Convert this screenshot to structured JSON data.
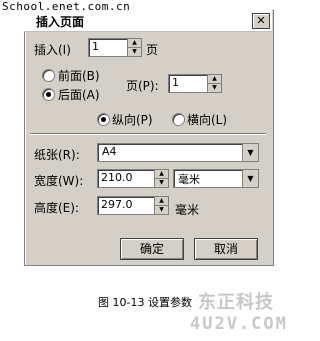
{
  "watermark_top": "School.enet.com.cn",
  "dialog": {
    "title": "插入页面",
    "close_glyph": "✕",
    "insert_label": "插入(I)",
    "insert_value": "1",
    "insert_unit": "页",
    "before_label": "前面(B)",
    "after_label": "后面(A)",
    "page_label": "页(P):",
    "page_value": "1",
    "portrait_label": "纵向(P)",
    "landscape_label": "横向(L)",
    "paper_label": "纸张(R):",
    "paper_value": "A4",
    "width_label": "宽度(W):",
    "width_value": "210.0",
    "unit_value": "毫米",
    "height_label": "高度(E):",
    "height_value": "297.0",
    "height_unit": "毫米",
    "ok_label": "确定",
    "cancel_label": "取消"
  },
  "caption": "图 10-13   设置参数",
  "watermark_logo_cn": "东正科技",
  "watermark_logo_en": "4U2V.COM"
}
